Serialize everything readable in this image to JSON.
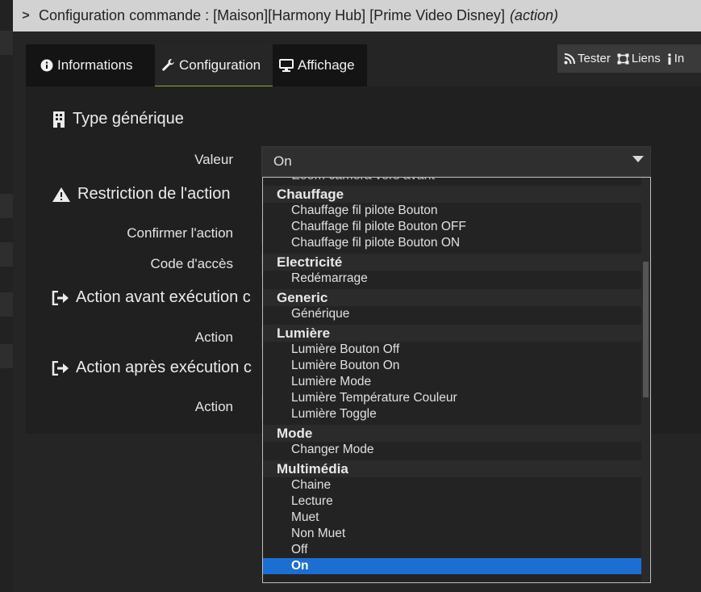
{
  "title": {
    "main": "Configuration commande : [Maison][Harmony Hub] [Prime Video Disney]",
    "suffix": "(action)"
  },
  "tabs": [
    {
      "label": "Informations",
      "icon": "info-circle-icon"
    },
    {
      "label": "Configuration",
      "icon": "wrench-icon"
    },
    {
      "label": "Affichage",
      "icon": "monitor-icon"
    }
  ],
  "actions": [
    {
      "label": "Tester",
      "icon": "rss-icon"
    },
    {
      "label": "Liens",
      "icon": "network-icon"
    },
    {
      "label": "In",
      "icon": "info-icon"
    }
  ],
  "sections": {
    "generic_type": {
      "title": "Type générique",
      "icon": "building-icon"
    },
    "restriction": {
      "title": "Restriction de l'action",
      "icon": "warning-icon"
    },
    "before": {
      "title": "Action avant exécution c",
      "icon": "sign-out-icon"
    },
    "after": {
      "title": "Action après exécution c",
      "icon": "sign-out-icon"
    }
  },
  "fields": {
    "valeur": "Valeur",
    "confirmer": "Confirmer l'action",
    "code": "Code d'accès",
    "action_before": "Action",
    "action_after": "Action"
  },
  "select": {
    "value": "On"
  },
  "dropdown": {
    "cut_top": "Zoom camera vers avant",
    "options": [
      {
        "type": "group",
        "label": "Chauffage"
      },
      {
        "type": "item",
        "label": "Chauffage fil pilote Bouton"
      },
      {
        "type": "item",
        "label": "Chauffage fil pilote Bouton OFF"
      },
      {
        "type": "item",
        "label": "Chauffage fil pilote Bouton ON"
      },
      {
        "type": "group",
        "label": "Electricité"
      },
      {
        "type": "item",
        "label": "Redémarrage"
      },
      {
        "type": "group",
        "label": "Generic"
      },
      {
        "type": "item",
        "label": "Générique"
      },
      {
        "type": "group",
        "label": "Lumière"
      },
      {
        "type": "item",
        "label": "Lumière Bouton Off"
      },
      {
        "type": "item",
        "label": "Lumière Bouton On"
      },
      {
        "type": "item",
        "label": "Lumière Mode"
      },
      {
        "type": "item",
        "label": "Lumière Température Couleur"
      },
      {
        "type": "item",
        "label": "Lumière Toggle"
      },
      {
        "type": "group",
        "label": "Mode"
      },
      {
        "type": "item",
        "label": "Changer Mode"
      },
      {
        "type": "group",
        "label": "Multimédia"
      },
      {
        "type": "item",
        "label": "Chaine"
      },
      {
        "type": "item",
        "label": "Lecture"
      },
      {
        "type": "item",
        "label": "Muet"
      },
      {
        "type": "item",
        "label": "Non Muet"
      },
      {
        "type": "item",
        "label": "Off"
      },
      {
        "type": "item",
        "label": "On",
        "selected": true
      }
    ]
  },
  "colors": {
    "selected": "#1c6fd0",
    "tab_active_underline": "#7fb03a",
    "titlebar": "#d2d2d2"
  }
}
